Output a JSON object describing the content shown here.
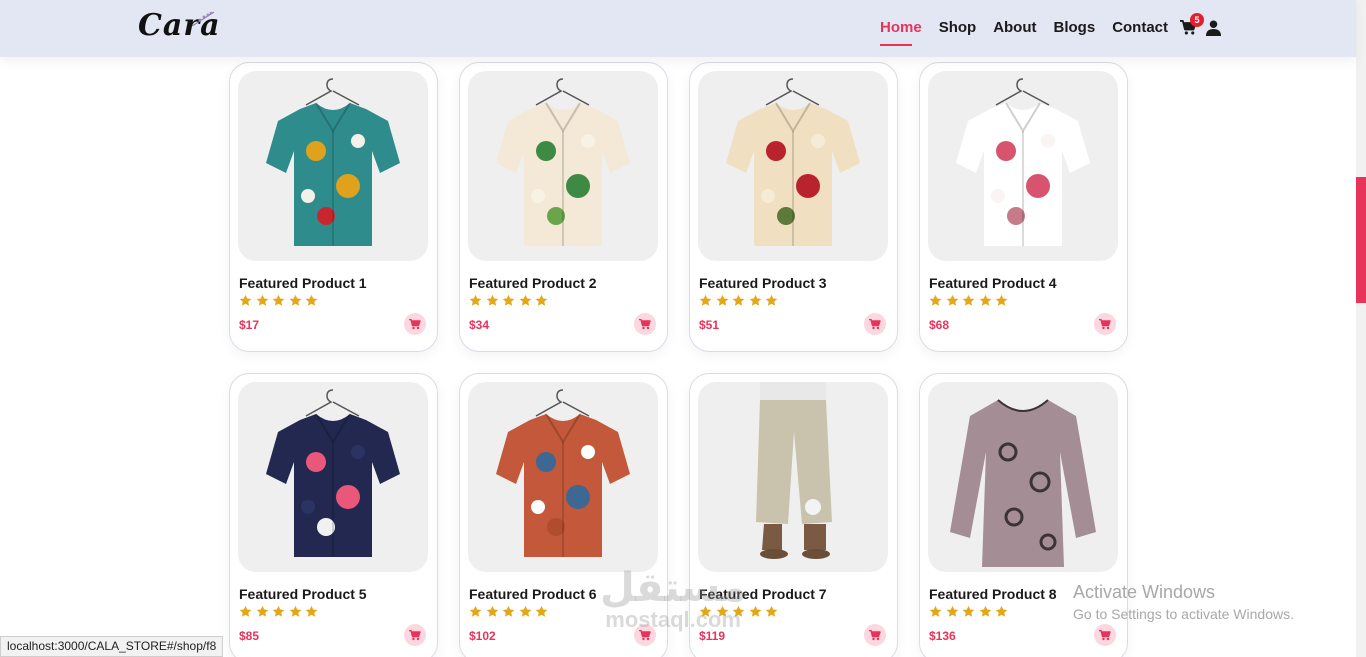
{
  "brand": {
    "name": "Cara"
  },
  "nav": {
    "items": [
      {
        "label": "Home",
        "active": true
      },
      {
        "label": "Shop",
        "active": false
      },
      {
        "label": "About",
        "active": false
      },
      {
        "label": "Blogs",
        "active": false
      },
      {
        "label": "Contact",
        "active": false
      }
    ],
    "cart_count": "5"
  },
  "products": [
    {
      "title": "Featured Product 1",
      "price": "$17",
      "rating": 5,
      "image": "floral-patchwork-shirt"
    },
    {
      "title": "Featured Product 2",
      "price": "$34",
      "rating": 5,
      "image": "tropical-leaf-shirt"
    },
    {
      "title": "Featured Product 3",
      "price": "$51",
      "rating": 5,
      "image": "rose-print-shirt"
    },
    {
      "title": "Featured Product 4",
      "price": "$68",
      "rating": 5,
      "image": "pink-blossom-shirt"
    },
    {
      "title": "Featured Product 5",
      "price": "$85",
      "rating": 5,
      "image": "navy-floral-shirt"
    },
    {
      "title": "Featured Product 6",
      "price": "$102",
      "rating": 5,
      "image": "two-tone-corduroy-shirt"
    },
    {
      "title": "Featured Product 7",
      "price": "$119",
      "rating": 5,
      "image": "linen-cropped-pants"
    },
    {
      "title": "Featured Product 8",
      "price": "$136",
      "rating": 5,
      "image": "mauve-print-blouse"
    }
  ],
  "status_bar": {
    "url": "localhost:3000/CALA_STORE#/shop/f8"
  },
  "os_overlay": {
    "title": "Activate Windows",
    "subtitle": "Go to Settings to activate Windows."
  },
  "watermark": {
    "arabic": "مستقل",
    "latin": "mostaql.com"
  },
  "colors": {
    "accent": "#e8335b",
    "star": "#e3a81a",
    "header_bg": "#e3e6f3"
  }
}
